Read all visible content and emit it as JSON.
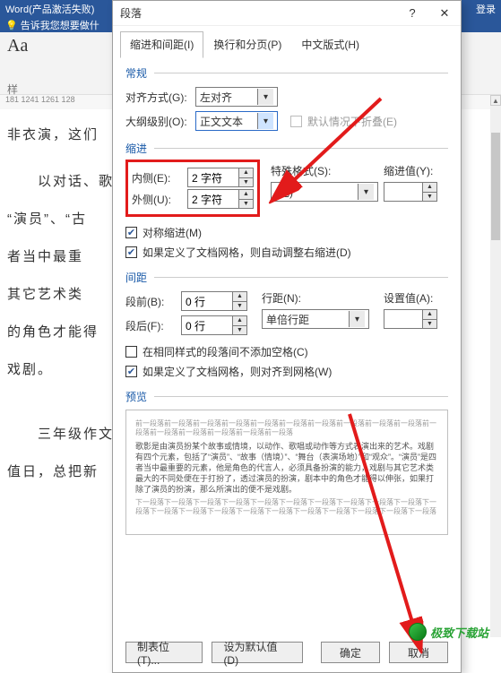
{
  "word_bg": {
    "title_fragment": "Word(产品激活失败)",
    "toolbar_hint": "告诉我您想要做什",
    "login": "登录",
    "ribbon_font": "Aa",
    "ribbon_group": "样",
    "ruler": "181   1241   1261   128",
    "t0": "非衣演，这们",
    "t1": "　　以对话、歌",
    "t2": "“演员”、“古",
    "t3": "者当中最重",
    "t4": "其它艺术类",
    "t5": "的角色才能得",
    "t6": "戏剧。",
    "t7": "　　三年级作文",
    "t8": "值日，总把新"
  },
  "dialog": {
    "title": "段落",
    "tabs": {
      "tab1": "缩进和间距(I)",
      "tab2": "换行和分页(P)",
      "tab3": "中文版式(H)"
    },
    "sec_general": "常规",
    "align_label": "对齐方式(G):",
    "align_value": "左对齐",
    "outline_label": "大纲级别(O):",
    "outline_value": "正文文本",
    "outline_chk": "默认情况下折叠(E)",
    "sec_indent": "缩进",
    "inside_label": "内侧(E):",
    "inside_value": "2 字符",
    "outside_label": "外侧(U):",
    "outside_value": "2 字符",
    "special_label": "特殊格式(S):",
    "special_value": "(无)",
    "indentval_label": "缩进值(Y):",
    "indentval_value": "",
    "mirror_chk": "对称缩进(M)",
    "grid_indent_chk": "如果定义了文档网格，则自动调整右缩进(D)",
    "sec_spacing": "间距",
    "before_label": "段前(B):",
    "before_value": "0 行",
    "after_label": "段后(F):",
    "after_value": "0 行",
    "linesp_label": "行距(N):",
    "linesp_value": "单倍行距",
    "setval_label": "设置值(A):",
    "setval_value": "",
    "nospace_chk": "在相同样式的段落间不添加空格(C)",
    "snapgrid_chk": "如果定义了文档网格，则对齐到网格(W)",
    "sec_preview": "预览",
    "preview_filler_top": "前一段落前一段落前一段落前一段落前一段落前一段落前一段落前一段落前一段落前一段落前一段落前一段落前一段落前一段落前一段落前一段落",
    "preview_main": "歌影是由演员扮某个故事或情境，以动作、歌唱或动作等方式表演出来的艺术。戏剧有四个元素，包括了“演员”、“故事（情境）”、“舞台（表演场地）”和“观众”。“演员”是四者当中最重要的元素，他是角色的代言人，必须具备扮演的能力，戏剧与其它艺术类最大的不同处便在于打扮了，透过演员的扮演，剧本中的角色才能得以伸张，如果打除了演员的扮演，那么所演出的便不是戏剧。",
    "preview_filler_bot": "下一段落下一段落下一段落下一段落下一段落下一段落下一段落下一段落下一段落下一段落下一段落下一段落下一段落下一段落下一段落下一段落下一段落下一段落下一段落下一段落下一段落",
    "btn_tabs": "制表位(T)...",
    "btn_default": "设为默认值(D)",
    "btn_ok": "确定",
    "btn_cancel": "取消"
  },
  "watermark": "极致下载站"
}
